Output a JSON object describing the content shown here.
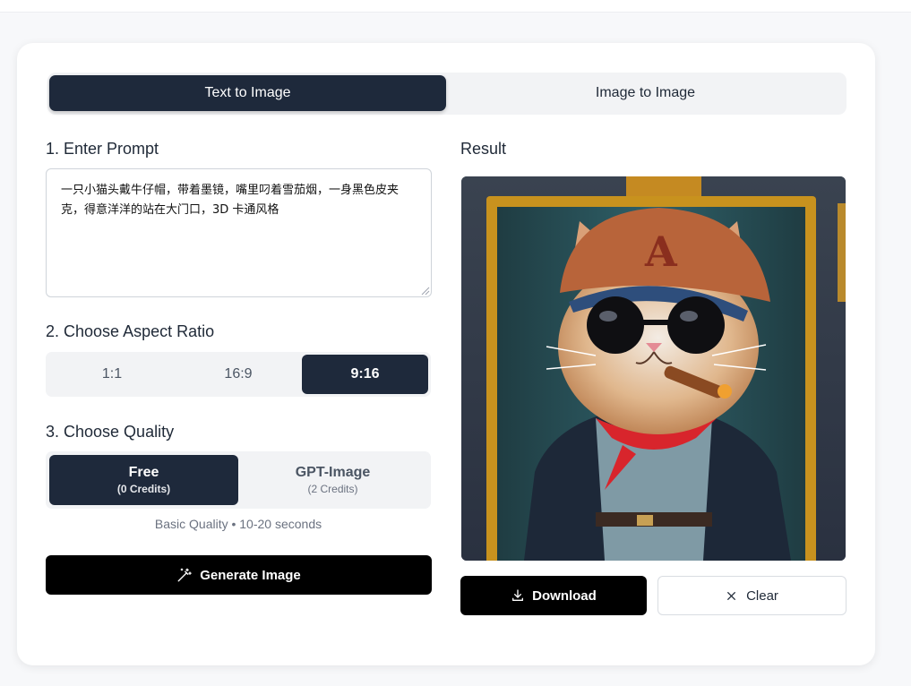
{
  "tabs": {
    "text_to_image": "Text to Image",
    "image_to_image": "Image to Image",
    "active": "text_to_image"
  },
  "prompt": {
    "label": "1. Enter Prompt",
    "value": "一只小猫头戴牛仔帽，带着墨镜，嘴里叼着雪茄烟，一身黑色皮夹克，得意洋洋的站在大门口，3D 卡通风格"
  },
  "aspect_ratio": {
    "label": "2. Choose Aspect Ratio",
    "options": [
      "1:1",
      "16:9",
      "9:16"
    ],
    "selected": "9:16"
  },
  "quality": {
    "label": "3. Choose Quality",
    "options": [
      {
        "title": "Free",
        "credits": "(0 Credits)"
      },
      {
        "title": "GPT-Image",
        "credits": "(2 Credits)"
      }
    ],
    "selected": "Free",
    "note": "Basic Quality • 10-20 seconds"
  },
  "generate": {
    "label": "Generate Image",
    "icon": "magic-wand-icon"
  },
  "result": {
    "label": "Result",
    "image_description": "cartoon-cat-with-cap-sunglasses-cigar-leather-jacket",
    "download_label": "Download",
    "clear_label": "Clear"
  },
  "colors": {
    "primary_dark": "#1e293b",
    "button_black": "#000000",
    "surface": "#f2f3f5"
  }
}
